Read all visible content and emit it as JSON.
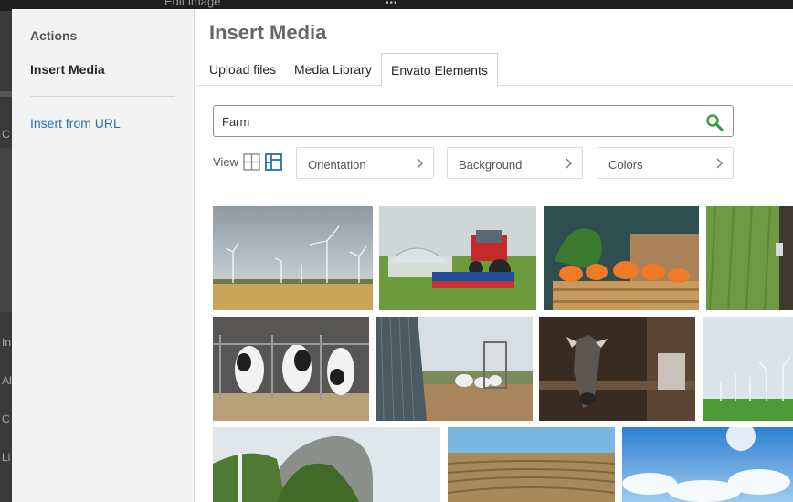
{
  "background": {
    "window_title": "Edit image",
    "left_letters": [
      "C",
      "In",
      "Al",
      "C",
      "Li"
    ]
  },
  "sidebar": {
    "heading": "Actions",
    "active_item": "Insert Media",
    "link": "Insert from URL"
  },
  "main": {
    "title": "Insert Media",
    "tabs": [
      {
        "label": "Upload files",
        "active": false
      },
      {
        "label": "Media Library",
        "active": false
      },
      {
        "label": "Envato Elements",
        "active": true
      }
    ],
    "search": {
      "value": "Farm",
      "icon": "search-icon"
    },
    "view": {
      "label": "View",
      "selected": "masonry"
    },
    "filters": [
      {
        "label": "Orientation"
      },
      {
        "label": "Background"
      },
      {
        "label": "Colors"
      }
    ]
  },
  "images": [
    {
      "subject": "wind turbines over wheat field"
    },
    {
      "subject": "red tractor near greenhouse"
    },
    {
      "subject": "crate of carrots"
    },
    {
      "subject": "green field with tree"
    },
    {
      "subject": "cows feeding in barn"
    },
    {
      "subject": "sheep by shed"
    },
    {
      "subject": "goat in barn"
    },
    {
      "subject": "wind turbines on green field"
    },
    {
      "subject": "forest and rocky mountain"
    },
    {
      "subject": "plowed field under blue sky"
    },
    {
      "subject": "blue sky with clouds"
    }
  ],
  "colors": {
    "accent": "#2271b1",
    "search_icon": "#3e9a3e"
  }
}
